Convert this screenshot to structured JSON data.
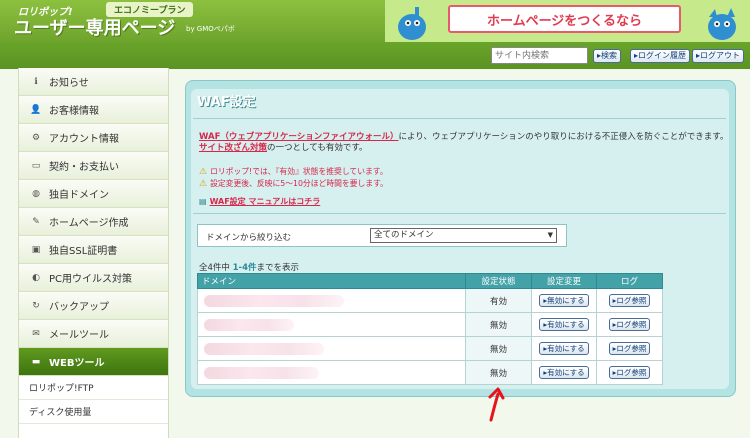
{
  "header": {
    "brand_top": "ロリポップ!",
    "plan": "エコノミープラン",
    "brand_main": "ユーザー専用ページ",
    "brand_sub": "by GMOペパボ",
    "banner_text": "ホームページをつくるなら"
  },
  "topbar": {
    "search_placeholder": "サイト内検索",
    "search_button": "検索",
    "login_history": "ログイン履歴",
    "logout": "ログアウト"
  },
  "sidebar": {
    "items": [
      {
        "label": "お知らせ",
        "icon": "info-icon"
      },
      {
        "label": "お客様情報",
        "icon": "user-icon"
      },
      {
        "label": "アカウント情報",
        "icon": "gear-icon"
      },
      {
        "label": "契約・お支払い",
        "icon": "card-icon"
      },
      {
        "label": "独自ドメイン",
        "icon": "globe-icon"
      },
      {
        "label": "ホームページ作成",
        "icon": "edit-icon"
      },
      {
        "label": "独自SSL証明書",
        "icon": "lock-icon"
      },
      {
        "label": "PC用ウイルス対策",
        "icon": "shield-icon"
      },
      {
        "label": "バックアップ",
        "icon": "backup-icon"
      },
      {
        "label": "メールツール",
        "icon": "mail-icon"
      },
      {
        "label": "WEBツール",
        "icon": "monitor-icon"
      }
    ],
    "subitems": [
      "ロリポップ!FTP",
      "ディスク使用量"
    ]
  },
  "main": {
    "title": "WAF設定",
    "desc_link1": "WAF（ウェブアプリケーションファイアウォール）",
    "desc_mid": "により、ウェブアプリケーションのやり取りにおける不正侵入を防ぐことができます。",
    "desc_link2": "サイト改ざん対策",
    "desc_end": "の一つとしても有効です。",
    "warning1": "ロリポップ!では、『有効』状態を推奨しています。",
    "warning2": "設定変更後、反映に5～10分ほど時間を要します。",
    "manual_link": "WAF設定 マニュアルはコチラ",
    "filter_label": "ドメインから絞り込む",
    "filter_value": "全てのドメイン",
    "count_prefix": "全4件中 ",
    "count_range": "1-4件",
    "count_suffix": "までを表示"
  },
  "table": {
    "headers": {
      "domain": "ドメイン",
      "status": "設定状態",
      "change": "設定変更",
      "log": "ログ"
    },
    "rows": [
      {
        "status": "有効",
        "action": "無効にする",
        "log": "ログ参照"
      },
      {
        "status": "無効",
        "action": "有効にする",
        "log": "ログ参照"
      },
      {
        "status": "無効",
        "action": "有効にする",
        "log": "ログ参照"
      },
      {
        "status": "無効",
        "action": "有効にする",
        "log": "ログ参照"
      }
    ]
  },
  "colors": {
    "accent_green": "#5f9a1e",
    "panel_teal": "#b3e3e3",
    "header_teal": "#43a1a8",
    "link_red": "#d8264a",
    "arrow_red": "#e8121a"
  }
}
